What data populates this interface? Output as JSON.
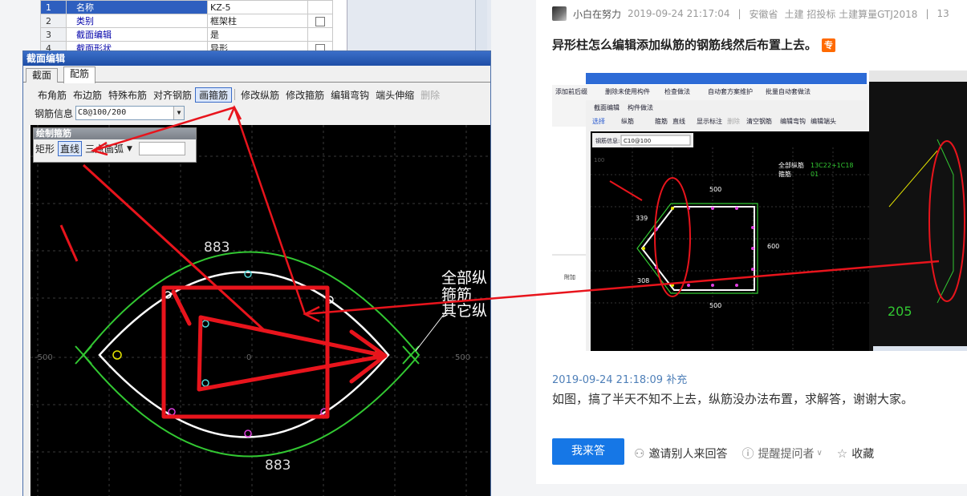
{
  "props_table": {
    "rows": [
      {
        "num": "1",
        "name": "名称",
        "value": "KZ-5",
        "checkbox": false
      },
      {
        "num": "2",
        "name": "类别",
        "value": "框架柱",
        "checkbox": true
      },
      {
        "num": "3",
        "name": "截面编辑",
        "value": "是",
        "checkbox": false
      },
      {
        "num": "4",
        "name": "截面形状",
        "value": "异形",
        "checkbox": true
      }
    ]
  },
  "dialog": {
    "title": "截面编辑",
    "tabs": [
      "截面",
      "配筋"
    ],
    "active_tab": "配筋",
    "toolbar": [
      "布角筋",
      "布边筋",
      "特殊布筋",
      "对齐钢筋",
      "画箍筋",
      "修改纵筋",
      "修改箍筋",
      "编辑弯钩",
      "端头伸缩",
      "删除"
    ],
    "toolbar_active": "画箍筋",
    "rebar_info_label": "钢筋信息",
    "rebar_info_value": "C8@100/200",
    "draw_panel": {
      "title": "绘制箍筋",
      "options": [
        "矩形",
        "直线",
        "三点画弧"
      ],
      "active": "直线"
    }
  },
  "cad": {
    "dim_top": "883",
    "dim_bottom": "883",
    "label_lines": [
      "全部纵",
      "箍筋",
      "其它纵"
    ],
    "axis_left": "-500",
    "axis_center": "0",
    "axis_right": "500"
  },
  "question": {
    "author": "小白在努力",
    "date": "2019-09-24 21:17:04",
    "location": "安徽省",
    "tags": "土建 招投标 土建算量GTJ2018",
    "views": "13",
    "title": "异形柱怎么编辑添加纵筋的钢筋线然后布置上去。",
    "badge": "专",
    "image": {
      "toolbar": [
        "添加前后缀",
        "删除未使用构件",
        "检查做法",
        "自动套方案维护",
        "批量自动套做法"
      ],
      "tabs": [
        "截面编辑",
        "构件做法"
      ],
      "tools": [
        "选择",
        "纵筋",
        "箍筋",
        "直线",
        "显示标注",
        "删除",
        "清空钢筋",
        "编辑弯钩",
        "编辑端头"
      ],
      "rebar_label": "钢筋信息:",
      "rebar_value": "C10@100",
      "legend_all": "全部纵筋",
      "legend_all_val": "13C22+1C18",
      "legend_stirrup": "箍筋",
      "legend_stirrup_val": "01",
      "dim_500_top": "500",
      "dim_339": "339",
      "dim_600": "600",
      "dim_308": "308",
      "dim_500_bottom": "500",
      "grid_nums": "100",
      "right_dim": "205",
      "side_label": "附加"
    },
    "supplement_time": "2019-09-24 21:18:09 补充",
    "supplement_text": "如图，搞了半天不知不上去，纵筋没办法布置，求解答，谢谢大家。"
  },
  "actions": {
    "answer_button": "我来答",
    "invite": "邀请别人来回答",
    "remind": "提醒提问者",
    "collect": "收藏"
  },
  "colors": {
    "primary": "#1677e6",
    "badge": "#ff6a00",
    "annotation": "#e8141c"
  }
}
